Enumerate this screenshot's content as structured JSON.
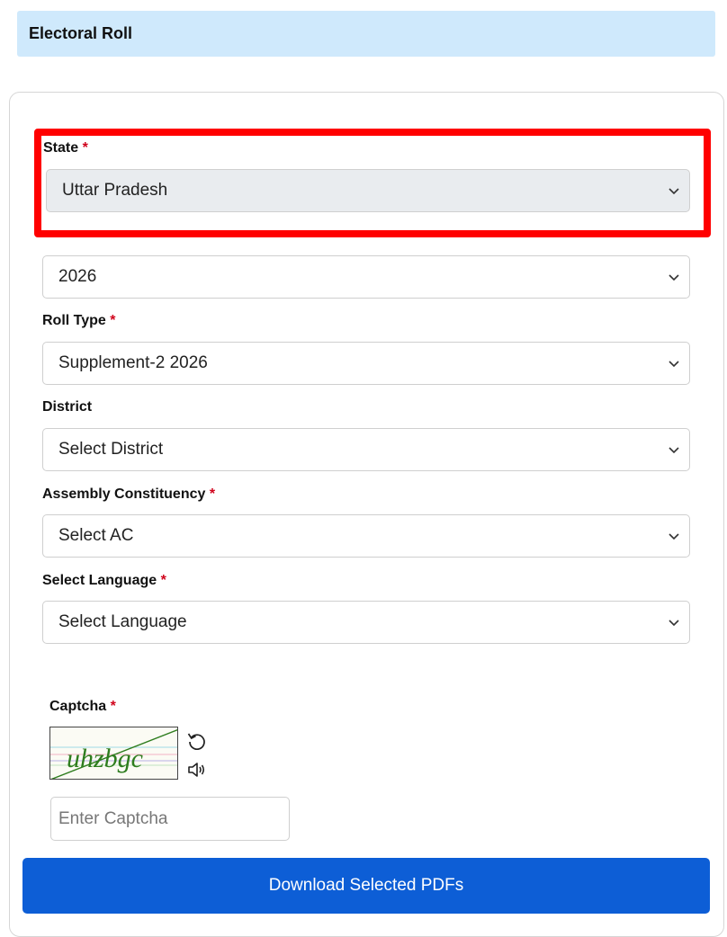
{
  "header": {
    "title": "Electoral Roll"
  },
  "required_mark": "*",
  "fields": {
    "state": {
      "label": "State",
      "value": "Uttar Pradesh"
    },
    "year": {
      "value": "2026"
    },
    "roll_type": {
      "label": "Roll Type",
      "value": "Supplement-2 2026"
    },
    "district": {
      "label": "District",
      "value": "Select District"
    },
    "assembly": {
      "label": "Assembly Constituency",
      "value": "Select AC"
    },
    "language": {
      "label": "Select Language",
      "value": "Select Language"
    }
  },
  "captcha": {
    "label": "Captcha",
    "image_text": "uhzbgc",
    "placeholder": "Enter Captcha",
    "refresh_icon": "refresh-icon",
    "audio_icon": "speaker-icon"
  },
  "actions": {
    "download_label": "Download Selected PDFs"
  },
  "colors": {
    "header_bg": "#cfe9fc",
    "highlight": "#ff0000",
    "required": "#d0021b",
    "primary_button": "#0d5ed6",
    "captcha_text": "#2e7d1e"
  }
}
